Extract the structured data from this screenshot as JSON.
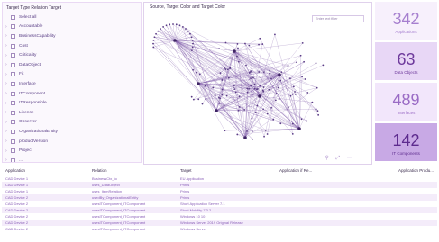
{
  "filter": {
    "title": "Target Type Relation Target",
    "items": [
      {
        "label": "Select all",
        "chevron": false
      },
      {
        "label": "Accountable",
        "chevron": true
      },
      {
        "label": "BusinessCapability",
        "chevron": true
      },
      {
        "label": "Cost",
        "chevron": true
      },
      {
        "label": "Criticality",
        "chevron": true
      },
      {
        "label": "DataObject",
        "chevron": true
      },
      {
        "label": "Fit",
        "chevron": true
      },
      {
        "label": "Interface",
        "chevron": true
      },
      {
        "label": "ITComponent",
        "chevron": true
      },
      {
        "label": "ITResponsible",
        "chevron": true
      },
      {
        "label": "License",
        "chevron": true
      },
      {
        "label": "Observer",
        "chevron": true
      },
      {
        "label": "OrganizationalEntity",
        "chevron": true
      },
      {
        "label": "productVersion",
        "chevron": true
      },
      {
        "label": "Project",
        "chevron": true
      },
      {
        "label": "...",
        "chevron": true
      }
    ]
  },
  "graph": {
    "title": "Source, Target Color and Target Color",
    "search_placeholder": "Enter text filter",
    "tools": "⚲ ⤢ ⋯",
    "colors": {
      "edge": "#7d5aa8",
      "node": "#5a3c86",
      "hub": "#3e2464"
    }
  },
  "cards": [
    {
      "value": "342",
      "label": "Applications",
      "bg": "#f7f0fc",
      "fg": "#a67fcf"
    },
    {
      "value": "63",
      "label": "Data Objects",
      "bg": "#e8d7f6",
      "fg": "#6e3a9c"
    },
    {
      "value": "489",
      "label": "Interfaces",
      "bg": "#f2e6fb",
      "fg": "#9a6bc5"
    },
    {
      "value": "142",
      "label": "IT Components",
      "bg": "#c8a9e5",
      "fg": "#5d2b8e"
    }
  ],
  "table": {
    "headers": [
      "Application",
      "Relation",
      "Target",
      "Application if Re...",
      "Application Produ..."
    ],
    "rows": [
      [
        "CAD Device 1",
        "BusinessCtx_to",
        "EU Application",
        "",
        ""
      ],
      [
        "CAD Device 1",
        "uses_DataObject",
        "Prints",
        "",
        ""
      ],
      [
        "CAD Device 1",
        "uses_ItemRelation",
        "Prints",
        "",
        ""
      ],
      [
        "CAD Device 2",
        "usedBy_OrganizationalEntity",
        "Prints",
        "",
        ""
      ],
      [
        "CAD Device 2",
        "usesITComponent_ITComponent",
        "Short Application Server 7.1",
        "",
        ""
      ],
      [
        "CAD Device 2",
        "usesITComponent_ITComponent",
        "Short Mobility 7.3.2",
        "",
        ""
      ],
      [
        "CAD Device 2",
        "usesITComponent_ITComponent",
        "Windows 10 10",
        "",
        ""
      ],
      [
        "CAD Device 2",
        "usesITComponent_ITComponent",
        "Windows Server 2019 Original Release",
        "",
        ""
      ],
      [
        "CAD Device 2",
        "usesITComponent_ITComponent",
        "Windows Server",
        "",
        ""
      ]
    ]
  }
}
